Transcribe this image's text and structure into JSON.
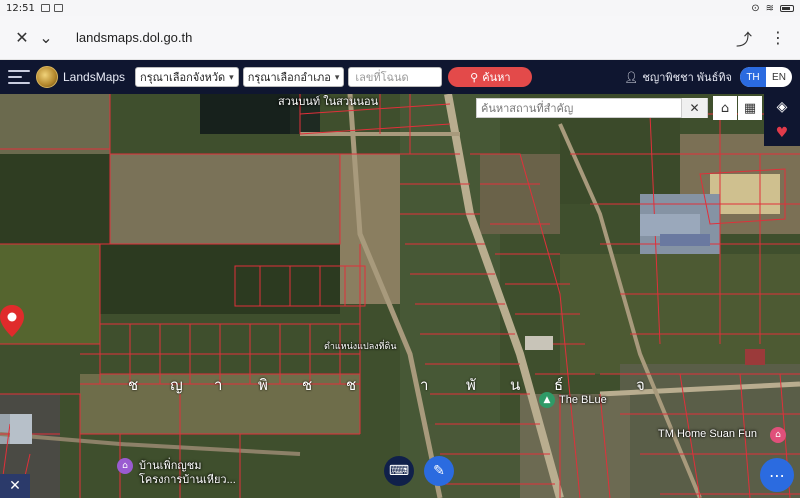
{
  "status_bar": {
    "time": "12:51"
  },
  "browser": {
    "url": "landsmaps.dol.go.th"
  },
  "header": {
    "brand": "LandsMaps",
    "province_select": "กรุณาเลือกจังหวัด",
    "district_select": "กรุณาเลือกอำเภอ",
    "deed_placeholder": "เลขที่โฉนด",
    "search_label": "ค้นหา",
    "user_name": "ชญาพิชชา พันธ์ทิจ",
    "lang_th": "TH",
    "lang_en": "EN"
  },
  "map": {
    "search_placeholder": "ค้นหาสถานที่สำคัญ",
    "pin_label": "ตำแหน่งแปลงที่ดิน",
    "owner_letters": [
      "ช",
      "ญ",
      "า",
      "พิ",
      "ช",
      "ช",
      "า",
      "พั",
      "น",
      "ธ์",
      "จ"
    ],
    "pois": {
      "top_place": "สวนบนท์ ในสวนนอน",
      "the_blue": "The BLue",
      "home_suan": "TM Home Suan Fun",
      "homestay_line1": "บ้านเพิ่กญชม",
      "homestay_line2": "โครงการบ้านเหียว..."
    },
    "colors": {
      "parcel_line": "#e0303a",
      "header_bg": "#0f1630",
      "accent": "#2b6be0",
      "search_red": "#e34a4a"
    }
  },
  "icons": [
    "close-icon",
    "chevron-down-icon",
    "share-icon",
    "more-icon",
    "user-icon",
    "home-icon",
    "grid-icon",
    "layers-icon",
    "heart-icon",
    "tools-icon",
    "keyboard-icon",
    "edit-icon",
    "dots-icon"
  ]
}
